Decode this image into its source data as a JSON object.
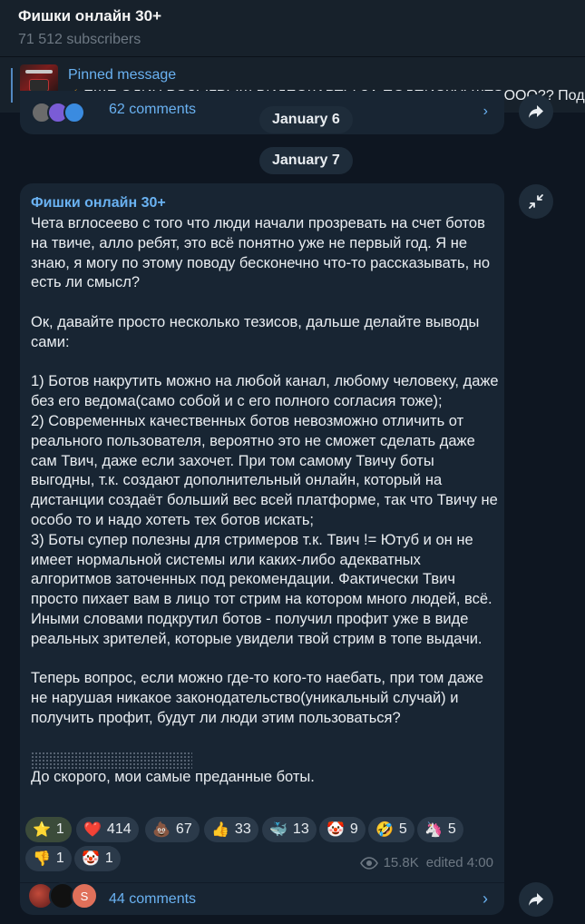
{
  "header": {
    "channel_title": "Фишки онлайн 30+",
    "subscribers": "71 512 subscribers"
  },
  "pinned": {
    "label": "Pinned message",
    "text": "ЕЩЕ ОДИН РОЗЫГРЫШ ВИДЕОКАРТЫ ЗА ПОДПИСКУ! ШТОООО??  Пода",
    "icon": "lightning-icon"
  },
  "previous_message": {
    "comments": "62 comments"
  },
  "dates": {
    "first": "January 6",
    "second": "January 7"
  },
  "post": {
    "sender": "Фишки онлайн 30+",
    "text": "Чета вглосеево с того что люди начали прозревать на счет ботов на твиче, алло ребят, это всё понятно уже не первый год. Я не знаю, я могу по этому поводу бесконечно что-то рассказывать, но есть ли смысл?\n\nОк, давайте просто несколько тезисов, дальше делайте выводы сами:\n\n1) Ботов накрутить можно на любой канал, любому человеку, даже без его ведома(само собой и с его полного согласия тоже);\n2) Современных качественных ботов невозможно отличить от реального пользователя, вероятно это не сможет сделать даже сам Твич, даже если захочет. При том самому Твичу боты выгодны, т.к. создают дополнительный онлайн, который на дистанции создаёт больший вес всей платформе, так что Твичу не особо то и надо хотеть тех ботов искать;\n3) Боты супер полезны для стримеров т.к. Твич != Ютуб и он не имеет нормальной системы или каких-либо адекватных алгоритмов заточенных под рекомендации. Фактически Твич просто пихает вам в лицо тот стрим на котором много людей, всё. Иными словами подкрутил ботов - получил профит уже в виде реальных зрителей, которые увидели твой стрим в топе выдачи.\n\nТеперь вопрос, если можно где-то кого-то наебать, при том даже не нарушая никакое законодательство(уникальный случай) и получить профит, будут ли люди этим пользоваться?\n\n\nДо скорого, мои самые преданные боты.",
    "reactions": [
      {
        "emoji": "⭐",
        "count": "1",
        "name": "star-reaction"
      },
      {
        "emoji": "❤️",
        "count": "414",
        "name": "heart-reaction"
      },
      {
        "emoji": "💩",
        "count": "67",
        "name": "poop-reaction"
      },
      {
        "emoji": "👍",
        "count": "33",
        "name": "thumbs-up-reaction"
      },
      {
        "emoji": "🐳",
        "count": "13",
        "name": "whale-reaction"
      },
      {
        "emoji": "🤡",
        "count": "9",
        "name": "clown-reaction"
      },
      {
        "emoji": "🤣",
        "count": "5",
        "name": "rofl-reaction"
      },
      {
        "emoji": "🦄",
        "count": "5",
        "name": "unicorn-reaction"
      },
      {
        "emoji": "👎",
        "count": "1",
        "name": "thumbs-down-reaction"
      },
      {
        "emoji": "🤡",
        "count": "1",
        "name": "clown-reaction-2"
      }
    ],
    "views": "15.8K",
    "edited": "edited 4:00",
    "comments": "44 comments",
    "comment_avatar_letter": "S"
  },
  "colors": {
    "background": "#0e1621",
    "bubble": "#182533",
    "accent": "#6ab2f2",
    "muted": "#6d7883"
  }
}
